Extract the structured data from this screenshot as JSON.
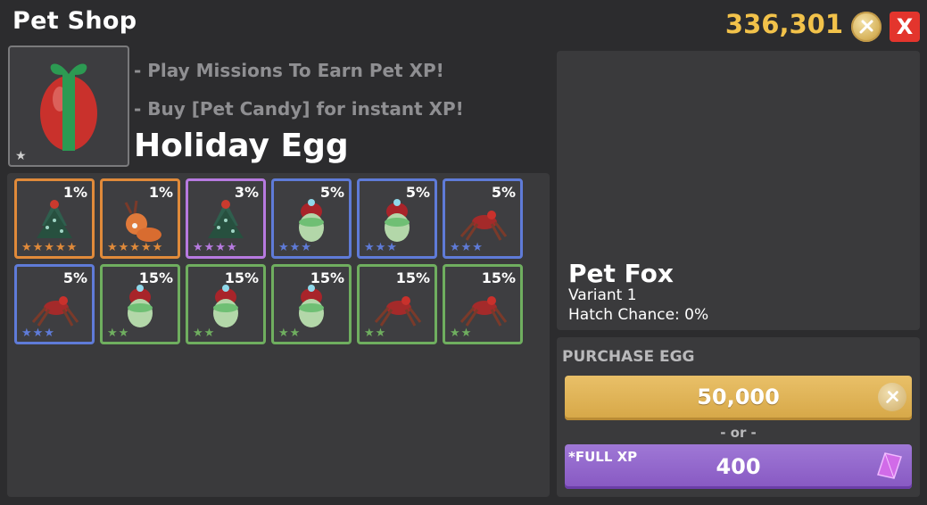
{
  "header": {
    "title": "Pet Shop",
    "coins": "336,301",
    "close_label": "X"
  },
  "egg": {
    "name": "Holiday Egg",
    "tips": [
      "- Play Missions To Earn Pet XP!",
      "- Buy [Pet Candy] for instant XP!"
    ],
    "icon": "holiday-egg-icon",
    "star": "★"
  },
  "pets": [
    {
      "chance": "1%",
      "stars": "★★★★★",
      "rarity": "orange",
      "icon": "tree-pet-icon"
    },
    {
      "chance": "1%",
      "stars": "★★★★★",
      "rarity": "orange",
      "icon": "reindeer-pet-icon"
    },
    {
      "chance": "3%",
      "stars": "★★★★",
      "rarity": "purple",
      "icon": "tree-pet-icon"
    },
    {
      "chance": "5%",
      "stars": "★★★",
      "rarity": "blue",
      "icon": "snowman-pet-icon"
    },
    {
      "chance": "5%",
      "stars": "★★★",
      "rarity": "blue",
      "icon": "snowman-pet-icon"
    },
    {
      "chance": "5%",
      "stars": "★★★",
      "rarity": "blue",
      "icon": "spider-pet-icon"
    },
    {
      "chance": "5%",
      "stars": "★★★",
      "rarity": "blue",
      "icon": "spider-pet-icon"
    },
    {
      "chance": "15%",
      "stars": "★★",
      "rarity": "green",
      "icon": "snowman-pet-icon"
    },
    {
      "chance": "15%",
      "stars": "★★",
      "rarity": "green",
      "icon": "snowman-pet-icon"
    },
    {
      "chance": "15%",
      "stars": "★★",
      "rarity": "green",
      "icon": "snowman-pet-icon"
    },
    {
      "chance": "15%",
      "stars": "★★",
      "rarity": "green",
      "icon": "spider-pet-icon"
    },
    {
      "chance": "15%",
      "stars": "★★",
      "rarity": "green",
      "icon": "spider-pet-icon"
    }
  ],
  "preview": {
    "name": "Pet Fox",
    "variant": "Variant 1",
    "hatch": "Hatch Chance: 0%"
  },
  "purchase": {
    "label": "PURCHASE EGG",
    "coin_price": "50,000",
    "or_label": "- or -",
    "xp_note": "*FULL XP",
    "gem_price": "400"
  },
  "colors": {
    "orange": "#e08a3a",
    "purple": "#b77ae0",
    "blue": "#5f7bd8",
    "green": "#6fae5f",
    "coin_text": "#f2c24a",
    "close": "#e3352d"
  }
}
